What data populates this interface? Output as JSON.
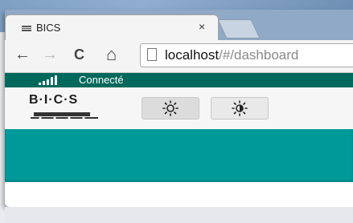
{
  "browser": {
    "tab_title": "BICS",
    "tab_close": "×",
    "url_host": "localhost",
    "url_path": "/#/dashboard",
    "nav": {
      "back": "←",
      "forward": "→",
      "reload": "C",
      "home": "⌂"
    }
  },
  "app": {
    "status_text": "Connecté",
    "logo_text": "B·I·C·S",
    "mode_buttons": [
      {
        "icon": "sun-icon",
        "active": true
      },
      {
        "icon": "day-night-icon",
        "active": false
      }
    ],
    "colors": {
      "statusbar": "#00695c",
      "content": "#009999"
    }
  }
}
